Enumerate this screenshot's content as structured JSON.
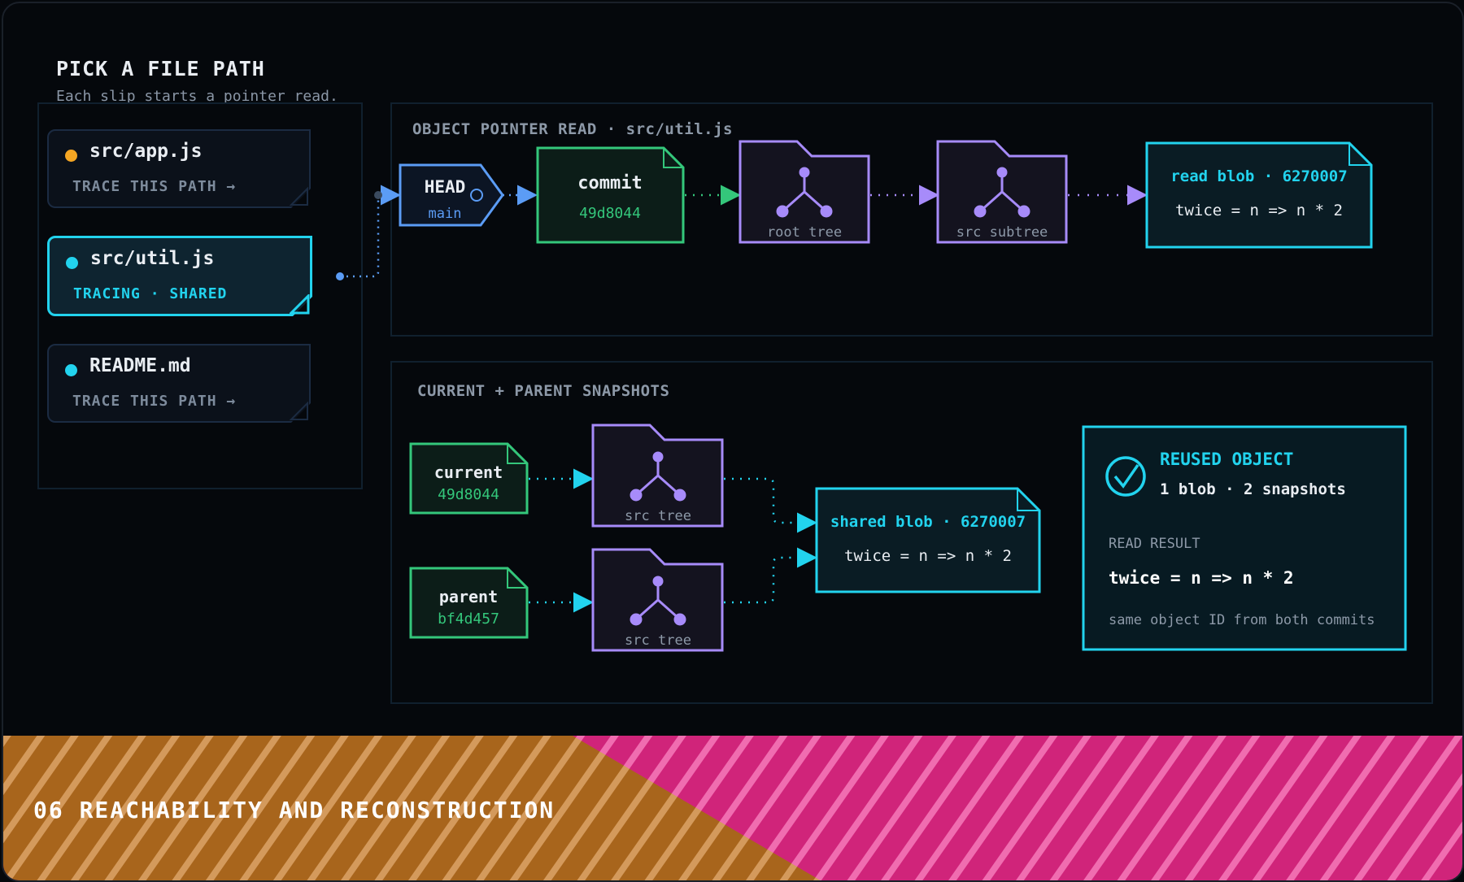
{
  "picker": {
    "title": "PICK A FILE PATH",
    "subtitle": "Each slip starts a pointer read.",
    "slips": [
      {
        "name": "src/app.js",
        "action": "TRACE THIS PATH →",
        "dot_color": "#f5a623",
        "active": false
      },
      {
        "name": "src/util.js",
        "action": "TRACING · SHARED",
        "dot_color": "#22d3ee",
        "active": true
      },
      {
        "name": "README.md",
        "action": "TRACE THIS PATH →",
        "dot_color": "#22d3ee",
        "active": false
      }
    ]
  },
  "pointer_read": {
    "label": "OBJECT POINTER READ · src/util.js",
    "head": {
      "title": "HEAD",
      "branch": "main"
    },
    "commit": {
      "title": "commit",
      "hash": "49d8044"
    },
    "root_tree": {
      "label": "root tree"
    },
    "src_subtree": {
      "label": "src subtree"
    },
    "blob": {
      "title": "read blob · 6270007",
      "content": "twice = n => n * 2"
    }
  },
  "snapshots": {
    "label": "CURRENT + PARENT SNAPSHOTS",
    "current": {
      "title": "current",
      "hash": "49d8044",
      "tree_label": "src tree"
    },
    "parent": {
      "title": "parent",
      "hash": "bf4d457",
      "tree_label": "src tree"
    },
    "shared_blob": {
      "title": "shared blob · 6270007",
      "content": "twice = n => n * 2"
    },
    "result": {
      "heading": "REUSED OBJECT",
      "summary": "1 blob · 2 snapshots",
      "read_label": "READ RESULT",
      "read_value": "twice = n => n * 2",
      "note": "same object ID from both commits"
    }
  },
  "banner": {
    "title": "06 REACHABILITY AND RECONSTRUCTION"
  },
  "colors": {
    "head": "#5b9cf5",
    "commit": "#34c77b",
    "tree": "#a78bfa",
    "blob": "#22d3ee",
    "orange_stripe": "#a8651c",
    "pink_stripe": "#d0247a"
  }
}
